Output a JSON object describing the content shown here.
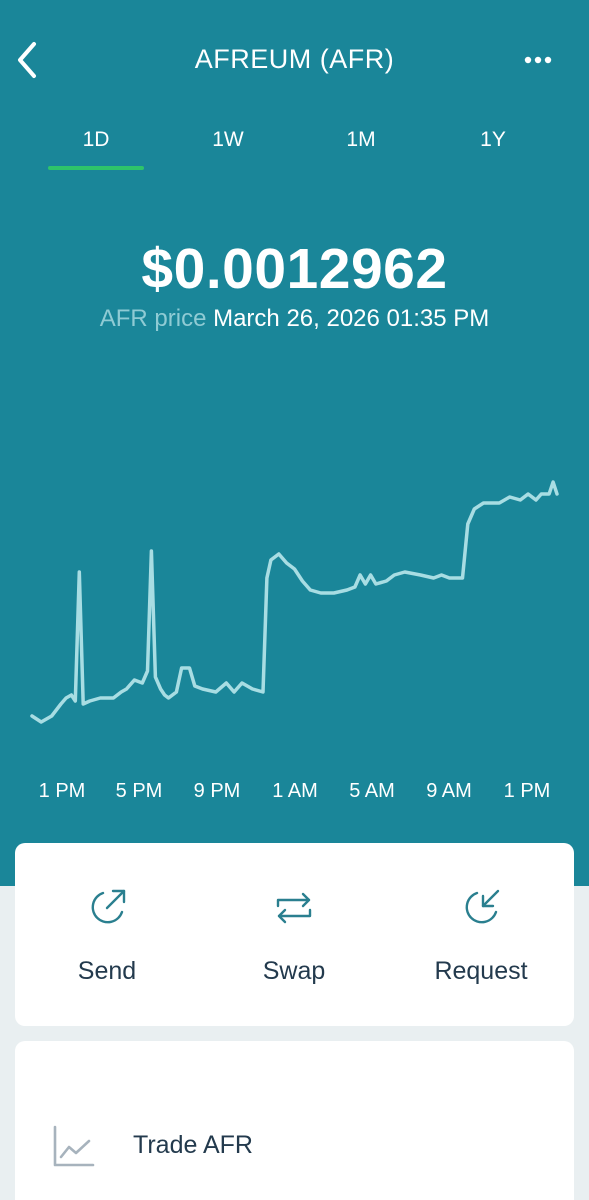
{
  "header": {
    "title": "AFREUM (AFR)",
    "back_icon": "chevron-left-icon",
    "more_icon": "more-horizontal-icon"
  },
  "tabs": [
    {
      "label": "1D",
      "selected": true
    },
    {
      "label": "1W",
      "selected": false
    },
    {
      "label": "1M",
      "selected": false
    },
    {
      "label": "1Y",
      "selected": false
    }
  ],
  "price": {
    "value": "$0.0012962",
    "label": "AFR price",
    "timestamp": "March 26, 2026 01:35 PM"
  },
  "chart_data": {
    "type": "line",
    "x_tick_labels": [
      "1 PM",
      "5 PM",
      "9 PM",
      "1 AM",
      "5 AM",
      "9 AM",
      "1 PM"
    ],
    "ylim": [
      0,
      100
    ],
    "grid": false,
    "series": [
      {
        "color": "#a8dde3",
        "points": [
          [
            0.0,
            4
          ],
          [
            0.35,
            2
          ],
          [
            0.75,
            4
          ],
          [
            1.1,
            8
          ],
          [
            1.3,
            10
          ],
          [
            1.5,
            11
          ],
          [
            1.65,
            9
          ],
          [
            1.8,
            52
          ],
          [
            1.95,
            8
          ],
          [
            2.2,
            9
          ],
          [
            2.6,
            10
          ],
          [
            3.1,
            10
          ],
          [
            3.4,
            12
          ],
          [
            3.6,
            13
          ],
          [
            3.9,
            16
          ],
          [
            4.2,
            15
          ],
          [
            4.4,
            19
          ],
          [
            4.55,
            59
          ],
          [
            4.7,
            17
          ],
          [
            4.9,
            13
          ],
          [
            5.05,
            11
          ],
          [
            5.2,
            10
          ],
          [
            5.5,
            12
          ],
          [
            5.7,
            20
          ],
          [
            6.0,
            20
          ],
          [
            6.2,
            14
          ],
          [
            6.5,
            13
          ],
          [
            7.0,
            12
          ],
          [
            7.4,
            15
          ],
          [
            7.7,
            12
          ],
          [
            8.0,
            15
          ],
          [
            8.4,
            13
          ],
          [
            8.8,
            12
          ],
          [
            8.95,
            50
          ],
          [
            9.1,
            56
          ],
          [
            9.4,
            58
          ],
          [
            9.7,
            55
          ],
          [
            10.0,
            53
          ],
          [
            10.3,
            49
          ],
          [
            10.6,
            46
          ],
          [
            11.0,
            45
          ],
          [
            11.5,
            45
          ],
          [
            12.0,
            46
          ],
          [
            12.3,
            47
          ],
          [
            12.5,
            51
          ],
          [
            12.7,
            48
          ],
          [
            12.9,
            51
          ],
          [
            13.1,
            48
          ],
          [
            13.5,
            49
          ],
          [
            13.8,
            51
          ],
          [
            14.2,
            52
          ],
          [
            14.8,
            51
          ],
          [
            15.3,
            50
          ],
          [
            15.6,
            51
          ],
          [
            15.9,
            50
          ],
          [
            16.4,
            50
          ],
          [
            16.6,
            68
          ],
          [
            16.85,
            73
          ],
          [
            17.2,
            75
          ],
          [
            17.8,
            75
          ],
          [
            18.2,
            77
          ],
          [
            18.6,
            76
          ],
          [
            18.9,
            78
          ],
          [
            19.2,
            76
          ],
          [
            19.4,
            78
          ],
          [
            19.7,
            78
          ],
          [
            19.85,
            82
          ],
          [
            20.0,
            78
          ]
        ]
      }
    ]
  },
  "actions": [
    {
      "label": "Send",
      "icon": "send-icon"
    },
    {
      "label": "Swap",
      "icon": "swap-arrows-icon"
    },
    {
      "label": "Request",
      "icon": "request-icon"
    }
  ],
  "trade": {
    "label": "Trade AFR",
    "icon": "line-chart-icon"
  }
}
